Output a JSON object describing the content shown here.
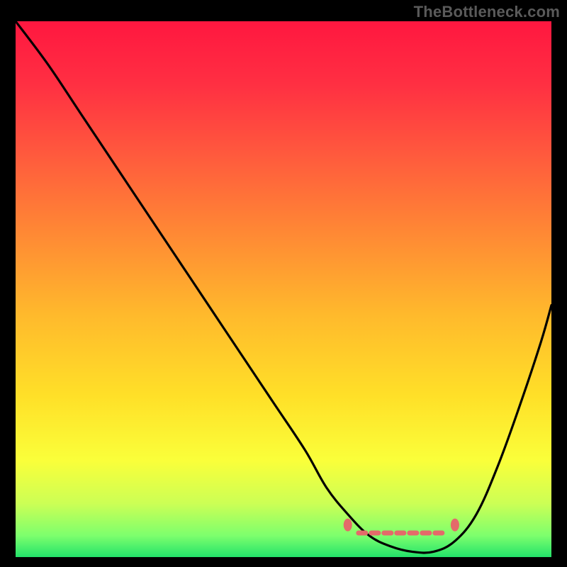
{
  "watermark": "TheBottleneck.com",
  "chart_data": {
    "type": "line",
    "title": "",
    "xlabel": "",
    "ylabel": "",
    "xlim": [
      0,
      100
    ],
    "ylim": [
      0,
      100
    ],
    "grid": false,
    "legend": false,
    "series": [
      {
        "name": "curve",
        "x": [
          0,
          6,
          12,
          18,
          24,
          30,
          36,
          42,
          48,
          54,
          58,
          62,
          66,
          70,
          74,
          78,
          82,
          86,
          90,
          94,
          98,
          100
        ],
        "y": [
          100,
          92,
          83,
          74,
          65,
          56,
          47,
          38,
          29,
          20,
          13,
          8,
          4,
          2,
          1,
          1,
          3,
          8,
          17,
          28,
          40,
          47
        ]
      }
    ],
    "markers": [
      {
        "name": "plateau-start",
        "x": 62,
        "y": 6
      },
      {
        "name": "plateau-end",
        "x": 82,
        "y": 6
      }
    ],
    "plateau_segment": {
      "x0": 64,
      "x1": 80,
      "y": 4.5
    },
    "gradient_stops": [
      {
        "pos": 0.0,
        "color": "#ff1740"
      },
      {
        "pos": 0.12,
        "color": "#ff3042"
      },
      {
        "pos": 0.25,
        "color": "#ff5a3d"
      },
      {
        "pos": 0.4,
        "color": "#ff8a34"
      },
      {
        "pos": 0.55,
        "color": "#ffba2c"
      },
      {
        "pos": 0.7,
        "color": "#ffe028"
      },
      {
        "pos": 0.82,
        "color": "#faff3a"
      },
      {
        "pos": 0.9,
        "color": "#ccff55"
      },
      {
        "pos": 0.96,
        "color": "#7dff6d"
      },
      {
        "pos": 1.0,
        "color": "#22e26a"
      }
    ]
  }
}
